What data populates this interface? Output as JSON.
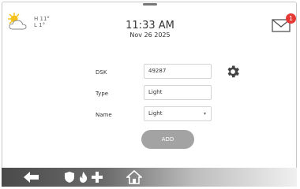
{
  "weather": {
    "icon": "partly-cloudy-icon",
    "high": "H 11°",
    "low": "L 1°"
  },
  "clock": {
    "time": "11:33 AM",
    "date": "Nov 26 2025"
  },
  "messages": {
    "icon": "mail-icon",
    "unread_count": "1",
    "badge_color": "#e53935"
  },
  "form": {
    "dsk": {
      "label": "DSK",
      "value": "49287"
    },
    "type": {
      "label": "Type",
      "value": "Light"
    },
    "name": {
      "label": "Name",
      "value": "Light"
    },
    "add_label": "ADD",
    "settings_icon": "gear-icon"
  },
  "bottom_nav": {
    "icons": [
      "back-arrow-icon",
      "security-shield-icon",
      "fire-icon",
      "medical-cross-icon",
      "home-icon"
    ]
  }
}
